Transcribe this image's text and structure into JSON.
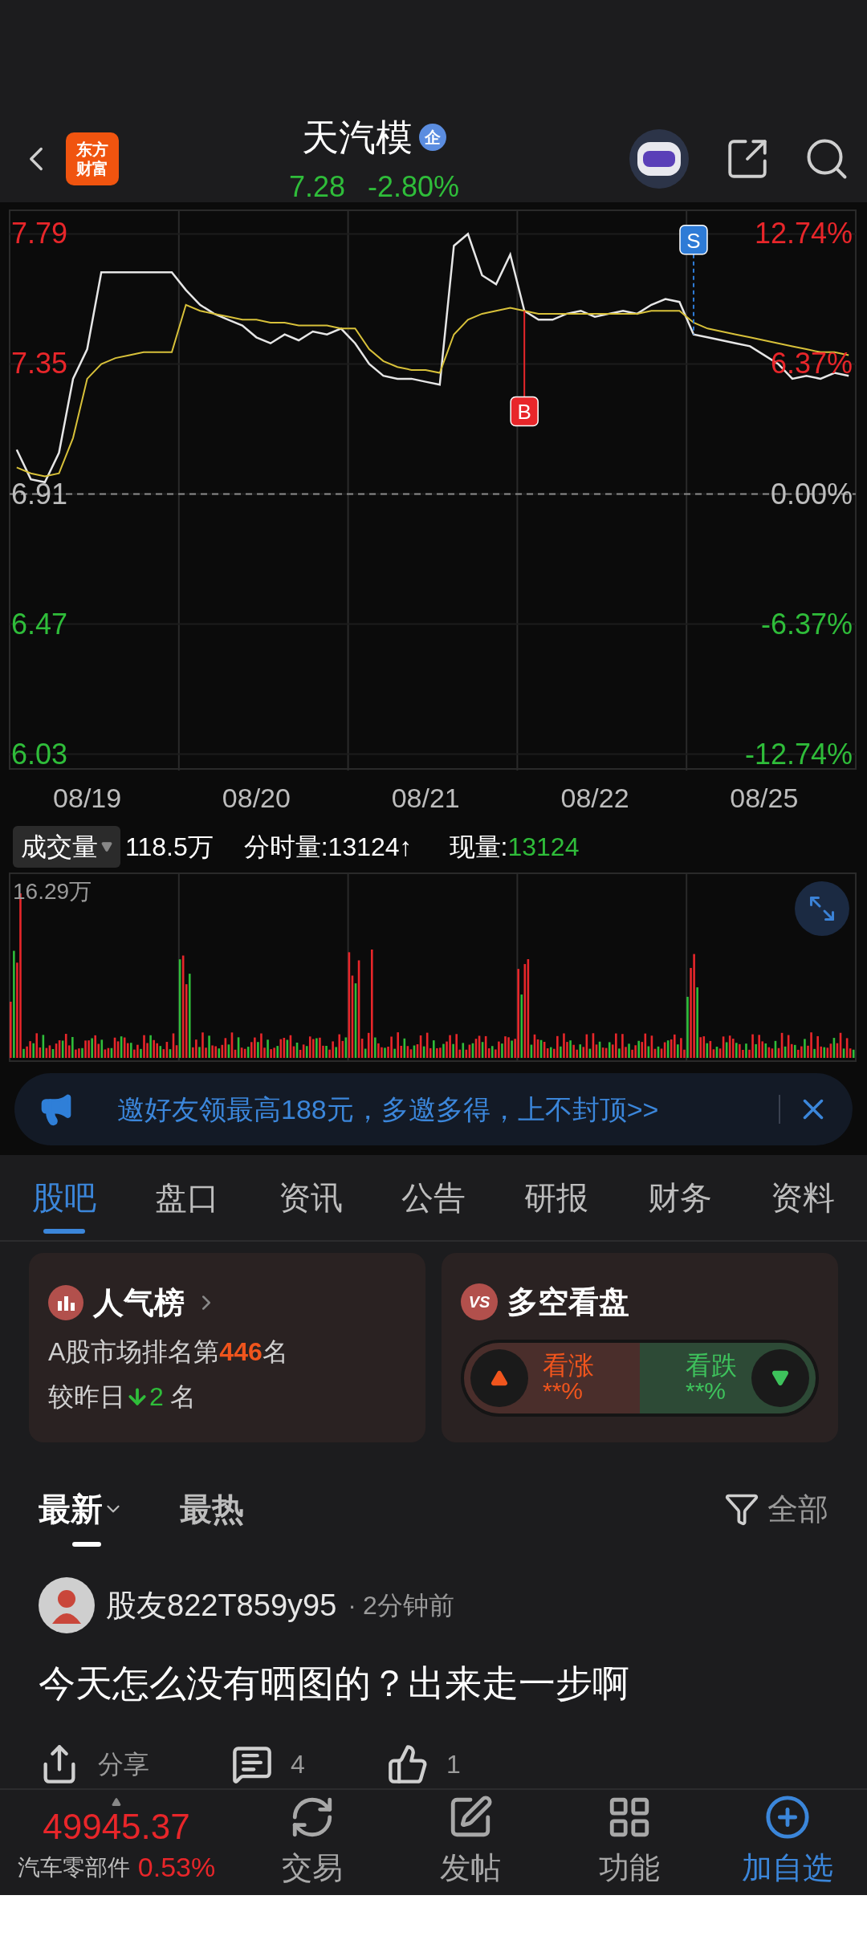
{
  "header": {
    "logo": [
      "东方",
      "财富"
    ],
    "title": "天汽模",
    "badge": "企",
    "price": "7.28",
    "change": "-2.80%",
    "rising": false
  },
  "price_chart": {
    "chart_data": {
      "type": "line",
      "categories": [
        null,
        null,
        null,
        null,
        null,
        "08/19",
        null,
        null,
        null,
        null,
        null,
        null,
        null,
        null,
        null,
        null,
        null,
        "08/20",
        null,
        null,
        null,
        null,
        null,
        null,
        null,
        null,
        null,
        null,
        null,
        "08/21",
        null,
        null,
        null,
        null,
        null,
        null,
        null,
        null,
        null,
        null,
        null,
        "08/22",
        null,
        null,
        null,
        null,
        null,
        null,
        null,
        null,
        null,
        null,
        null,
        "08/25",
        null,
        null,
        null,
        null,
        null,
        null
      ],
      "series": [
        {
          "color": "#e6e6e6",
          "values": [
            7.06,
            6.96,
            6.95,
            7.05,
            7.3,
            7.4,
            7.66,
            7.66,
            7.66,
            7.66,
            7.66,
            7.66,
            7.6,
            7.55,
            7.52,
            7.5,
            7.48,
            7.44,
            7.42,
            7.45,
            7.43,
            7.46,
            7.45,
            7.47,
            7.42,
            7.35,
            7.31,
            7.3,
            7.3,
            7.29,
            7.28,
            7.75,
            7.79,
            7.65,
            7.62,
            7.72,
            7.53,
            7.5,
            7.5,
            7.52,
            7.53,
            7.51,
            7.52,
            7.53,
            7.52,
            7.55,
            7.57,
            7.56,
            7.45,
            7.44,
            7.43,
            7.42,
            7.41,
            7.38,
            7.35,
            7.3,
            7.31,
            7.3,
            7.32,
            7.31
          ]
        },
        {
          "color": "#d8c13a",
          "values": [
            7.0,
            6.98,
            6.97,
            6.98,
            7.1,
            7.3,
            7.35,
            7.37,
            7.38,
            7.39,
            7.39,
            7.39,
            7.55,
            7.53,
            7.52,
            7.51,
            7.5,
            7.5,
            7.49,
            7.49,
            7.48,
            7.48,
            7.48,
            7.47,
            7.47,
            7.4,
            7.36,
            7.34,
            7.33,
            7.33,
            7.32,
            7.45,
            7.5,
            7.52,
            7.53,
            7.54,
            7.53,
            7.52,
            7.52,
            7.52,
            7.52,
            7.52,
            7.52,
            7.52,
            7.52,
            7.53,
            7.53,
            7.53,
            7.49,
            7.47,
            7.46,
            7.45,
            7.44,
            7.43,
            7.42,
            7.41,
            7.4,
            7.39,
            7.39,
            7.38
          ]
        }
      ],
      "ylim": [
        5.98,
        7.87
      ],
      "yticks": [
        {
          "value": 7.79,
          "label": "7.79"
        },
        {
          "value": 7.35,
          "label": "7.35"
        },
        {
          "value": 6.91,
          "label": "6.91"
        },
        {
          "value": 6.47,
          "label": "6.47"
        },
        {
          "value": 6.03,
          "label": "6.03"
        }
      ],
      "grid": true,
      "ref_lines": [
        {
          "axis": "y",
          "value": 6.91
        }
      ]
    },
    "trade_markers": [
      {
        "kind": "buy",
        "text": "B"
      },
      {
        "kind": "sell",
        "text": "S"
      }
    ],
    "right_labels": [
      "12.74%",
      "6.37%",
      "0.00%",
      "-6.37%",
      "-12.74%"
    ]
  },
  "volume": {
    "selector": "成交量",
    "total": "118.5万",
    "tick_volume": "分时量:13124↑",
    "current_label": "现量:",
    "current_value": "13124",
    "max_label": "16.29万"
  },
  "banner": {
    "text": "邀好友领最高188元，多邀多得，上不封顶>>"
  },
  "tabs": [
    {
      "label": "股吧",
      "selected": true
    },
    {
      "label": "盘口",
      "selected": false
    },
    {
      "label": "资讯",
      "selected": false
    },
    {
      "label": "公告",
      "selected": false
    },
    {
      "label": "研报",
      "selected": false
    },
    {
      "label": "财务",
      "selected": false
    },
    {
      "label": "资料",
      "selected": false
    }
  ],
  "popularity_card": {
    "title": "人气榜",
    "rank_prefix": "A股市场排名第",
    "rank": "446",
    "rank_suffix": "名",
    "change_prefix": "较昨日",
    "rank_fell": true,
    "change": "2",
    "change_suffix": "名"
  },
  "sentiment_card": {
    "icon_text": "VS",
    "title": "多空看盘",
    "bull_label": "看涨",
    "bull_value": "**%",
    "bear_label": "看跌",
    "bear_value": "**%"
  },
  "sort_tabs": [
    {
      "label": "最新",
      "selected": true
    },
    {
      "label": "最热",
      "selected": false
    }
  ],
  "filter": {
    "label": "全部"
  },
  "post": {
    "user": "股友822T859y95",
    "separator": "·",
    "time": "2分钟前",
    "content": "今天怎么没有晒图的？出来走一步啊",
    "share": "分享",
    "comments": "4",
    "likes": "1"
  },
  "bottom_bar": {
    "index_value": "49945.37",
    "sector": "汽车零部件",
    "sector_change": "0.53%",
    "rising": true,
    "items": [
      {
        "kind": "trade",
        "label": "交易",
        "active": false
      },
      {
        "kind": "post",
        "label": "发帖",
        "active": false
      },
      {
        "kind": "functions",
        "label": "功能",
        "active": false
      },
      {
        "kind": "add",
        "label": "加自选",
        "active": true
      }
    ]
  }
}
